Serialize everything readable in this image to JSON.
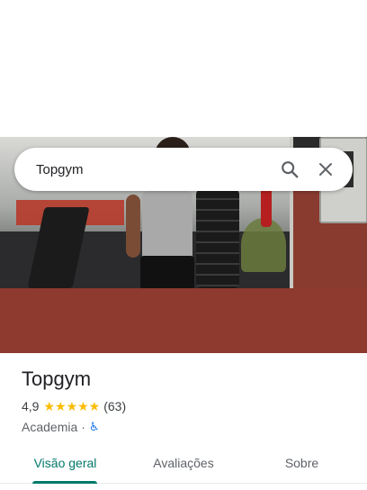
{
  "search": {
    "query": "Topgym"
  },
  "icons": {
    "search": "search-icon",
    "close": "close-icon",
    "star": "star-icon",
    "accessibility": "wheelchair-icon"
  },
  "place": {
    "name": "Topgym",
    "rating": "4,9",
    "stars": "★★★★★",
    "review_count": "(63)",
    "category": "Academia",
    "separator": "·",
    "accessibility_symbol": "♿"
  },
  "tabs": [
    {
      "label": "Visão geral",
      "selected": true
    },
    {
      "label": "Avaliações",
      "selected": false
    },
    {
      "label": "Sobre",
      "selected": false
    }
  ],
  "colors": {
    "accent": "#00796b",
    "star": "#fbbc04",
    "accessibility": "#1a73e8"
  }
}
